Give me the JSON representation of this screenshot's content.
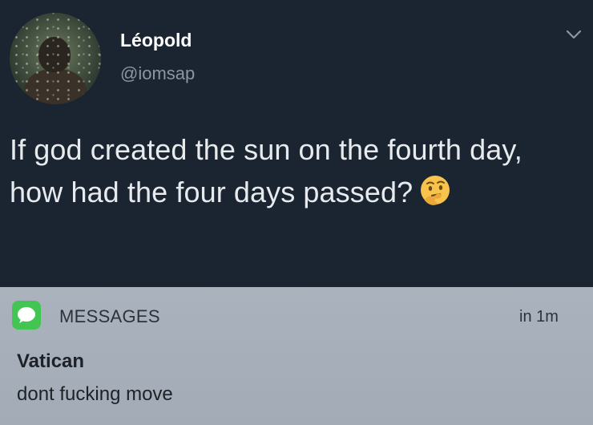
{
  "tweet": {
    "author_name": "Léopold",
    "author_handle": "@iomsap",
    "text": "If god created the sun on the fourth day, how had the four days passed?",
    "emoji": "thinking-face-emoji"
  },
  "notification": {
    "app_name": "MESSAGES",
    "time": "in 1m",
    "sender": "Vatican",
    "message": "dont fucking move",
    "app_icon": "messages-app-icon",
    "accent_color": "#42c553"
  },
  "colors": {
    "tweet_background": "#1b2431",
    "notification_background": "#a8b0bb"
  }
}
